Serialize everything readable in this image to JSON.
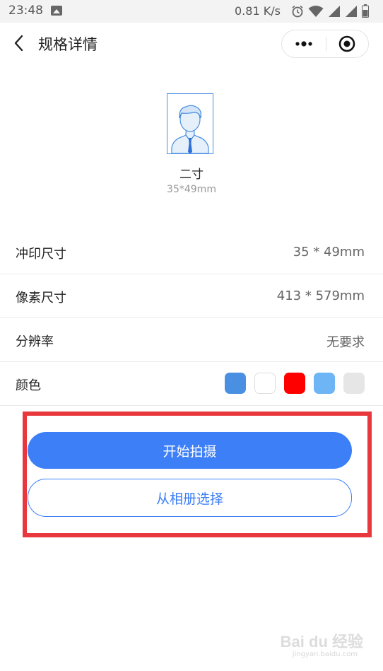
{
  "status_bar": {
    "time": "23:48",
    "network_speed": "0.81 K/s",
    "icons": [
      "gallery-icon",
      "alarm-icon",
      "wifi-icon",
      "signal-icon",
      "signal-icon",
      "battery-icon"
    ]
  },
  "nav": {
    "title": "规格详情",
    "back_icon": "chevron-left-icon",
    "more_icon": "more-dots-icon",
    "close_icon": "target-circle-icon"
  },
  "spec": {
    "name": "二寸",
    "size": "35*49mm",
    "image_icon": "id-photo-person-icon"
  },
  "rows": [
    {
      "label": "冲印尺寸",
      "value": "35 * 49mm"
    },
    {
      "label": "像素尺寸",
      "value": "413 * 579mm"
    },
    {
      "label": "分辨率",
      "value": "无要求"
    },
    {
      "label": "颜色",
      "value": ""
    }
  ],
  "colors": [
    {
      "name": "blue",
      "hex": "#4a90e2"
    },
    {
      "name": "white",
      "hex": "#ffffff"
    },
    {
      "name": "red",
      "hex": "#ff0000"
    },
    {
      "name": "light-blue",
      "hex": "#6db5f5"
    },
    {
      "name": "gray",
      "hex": "#e6e6e6"
    }
  ],
  "buttons": {
    "primary": "开始拍摄",
    "secondary": "从相册选择"
  },
  "accent_color": "#3d7ff6",
  "highlight_color": "#e8383d",
  "watermark": {
    "text": "Bai du 经验",
    "url": "jingyan.baidu.com"
  }
}
